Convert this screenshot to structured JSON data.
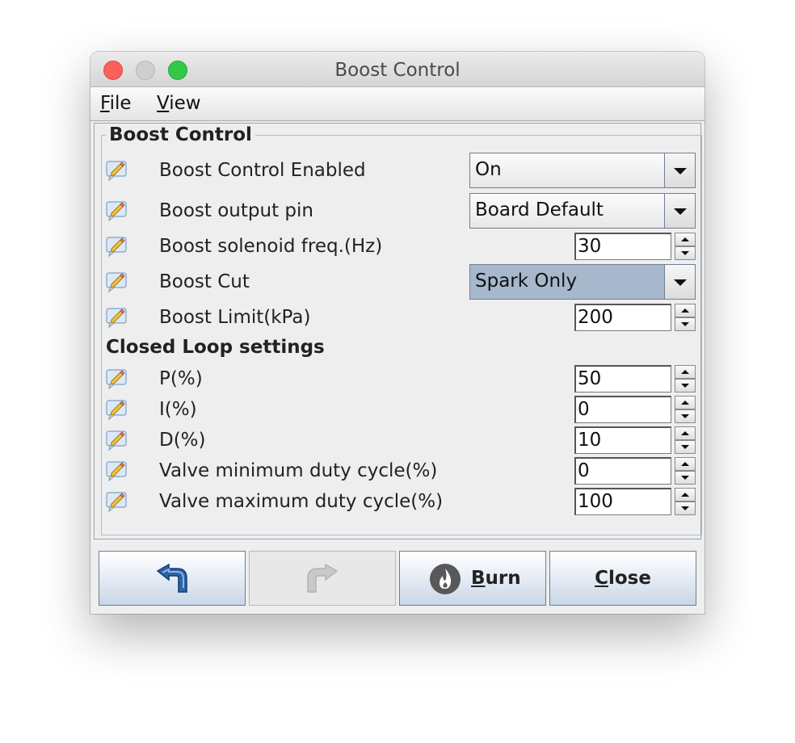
{
  "window": {
    "title": "Boost Control"
  },
  "menu": [
    {
      "mnemonic": "F",
      "rest": "ile"
    },
    {
      "mnemonic": "V",
      "rest": "iew"
    }
  ],
  "group": {
    "title": "Boost Control"
  },
  "rows": [
    {
      "label": "Boost Control Enabled",
      "control": "combo",
      "value": "On"
    },
    {
      "label": "Boost output pin",
      "control": "combo",
      "value": "Board Default"
    },
    {
      "label": "Boost solenoid freq.(Hz)",
      "control": "spinner",
      "value": "30"
    },
    {
      "label": "Boost Cut",
      "control": "combo",
      "value": "Spark Only"
    },
    {
      "label": "Boost Limit(kPa)",
      "control": "spinner",
      "value": "200"
    }
  ],
  "closed_loop": {
    "title": "Closed Loop settings",
    "rows": [
      {
        "label": "P(%)",
        "value": "50"
      },
      {
        "label": "I(%)",
        "value": "0"
      },
      {
        "label": "D(%)",
        "value": "10"
      },
      {
        "label": "Valve minimum duty cycle(%)",
        "value": "0"
      },
      {
        "label": "Valve maximum duty cycle(%)",
        "value": "100"
      }
    ]
  },
  "buttons": {
    "undo_icon": "undo-arrow-icon",
    "redo_icon": "redo-arrow-icon",
    "burn": {
      "mnemonic": "B",
      "rest": "urn"
    },
    "close": {
      "mnemonic": "C",
      "rest": "lose"
    }
  },
  "colors": {
    "accent": "#a7b8cc",
    "close_light": "#fc605b",
    "max_light": "#34c84a"
  }
}
